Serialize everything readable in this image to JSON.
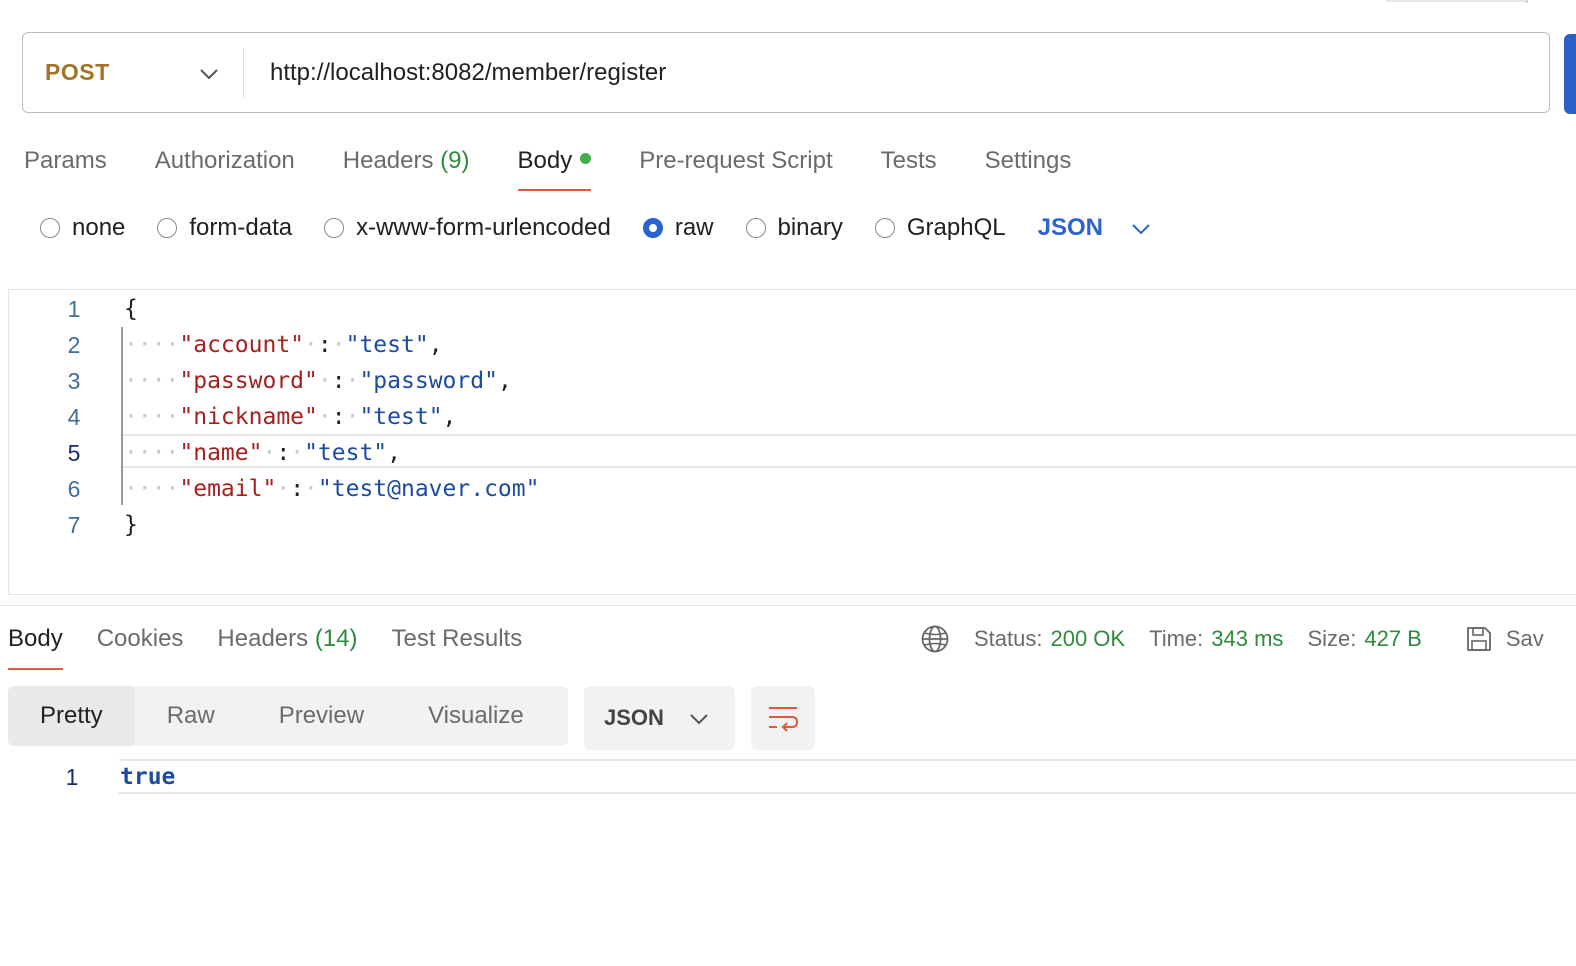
{
  "request": {
    "method": "POST",
    "url": "http://localhost:8082/member/register"
  },
  "request_tabs": [
    {
      "label": "Params"
    },
    {
      "label": "Authorization"
    },
    {
      "label": "Headers",
      "count": "(9)"
    },
    {
      "label": "Body",
      "active": true,
      "has_dot": true
    },
    {
      "label": "Pre-request Script"
    },
    {
      "label": "Tests"
    },
    {
      "label": "Settings"
    }
  ],
  "body_types": [
    {
      "label": "none",
      "selected": false
    },
    {
      "label": "form-data",
      "selected": false
    },
    {
      "label": "x-www-form-urlencoded",
      "selected": false
    },
    {
      "label": "raw",
      "selected": true
    },
    {
      "label": "binary",
      "selected": false
    },
    {
      "label": "GraphQL",
      "selected": false
    }
  ],
  "body_language": "JSON",
  "editor": {
    "current_line": 5,
    "lines": [
      {
        "n": "1",
        "open": "{"
      },
      {
        "n": "2",
        "key": "\"account\"",
        "value": "\"test\"",
        "trail": ","
      },
      {
        "n": "3",
        "key": "\"password\"",
        "value": "\"password\"",
        "trail": ","
      },
      {
        "n": "4",
        "key": "\"nickname\"",
        "value": "\"test\"",
        "trail": ","
      },
      {
        "n": "5",
        "key": "\"name\"",
        "value": "\"test\"",
        "trail": ","
      },
      {
        "n": "6",
        "key": "\"email\"",
        "value": "\"test@naver.com\"",
        "trail": ""
      },
      {
        "n": "7",
        "close": "}"
      }
    ]
  },
  "response_tabs": [
    {
      "label": "Body",
      "active": true
    },
    {
      "label": "Cookies"
    },
    {
      "label": "Headers",
      "count": "(14)"
    },
    {
      "label": "Test Results"
    }
  ],
  "response_meta": {
    "status_label": "Status:",
    "status_value": "200 OK",
    "time_label": "Time:",
    "time_value": "343 ms",
    "size_label": "Size:",
    "size_value": "427 B",
    "save_label": "Sav"
  },
  "response_views": [
    "Pretty",
    "Raw",
    "Preview",
    "Visualize"
  ],
  "response_format": "JSON",
  "response_body": {
    "line_number": "1",
    "value": "true"
  },
  "colors": {
    "method": "#a07424",
    "accent_tab": "#e0593a",
    "link_blue": "#2c62d1",
    "success_green": "#2e8b3c",
    "json_key": "#a3211f",
    "json_string": "#1c4ba0"
  }
}
